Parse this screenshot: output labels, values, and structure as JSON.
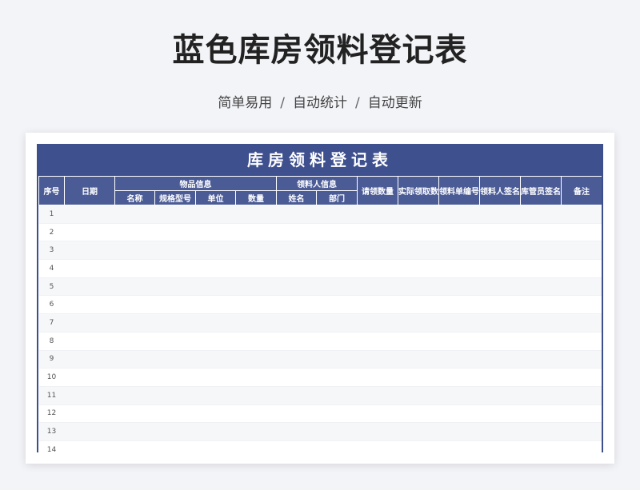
{
  "page": {
    "title": "蓝色库房领料登记表",
    "subtitle": {
      "parts": [
        "简单易用",
        "自动统计",
        "自动更新"
      ],
      "separator": "/"
    }
  },
  "sheet": {
    "title": "库房领料登记表",
    "header": {
      "seq": "序号",
      "date": "日期",
      "item_group": "物品信息",
      "item_name": "名称",
      "item_spec": "规格型号",
      "item_unit": "单位",
      "item_qty": "数量",
      "receiver_group": "领料人信息",
      "receiver_name": "姓名",
      "receiver_dept": "部门",
      "requested_qty": "请领数量",
      "actual_qty": "实际领取数量",
      "order_no": "领料单编号",
      "receiver_sign": "领料人签名",
      "keeper_sign": "库管员签名",
      "remark": "备注"
    },
    "rows": [
      {
        "seq": "1"
      },
      {
        "seq": "2"
      },
      {
        "seq": "3"
      },
      {
        "seq": "4"
      },
      {
        "seq": "5"
      },
      {
        "seq": "6"
      },
      {
        "seq": "7"
      },
      {
        "seq": "8"
      },
      {
        "seq": "9"
      },
      {
        "seq": "10"
      },
      {
        "seq": "11"
      },
      {
        "seq": "12"
      },
      {
        "seq": "13"
      },
      {
        "seq": "14"
      }
    ]
  },
  "colors": {
    "header_bg": "#4b5b96",
    "title_bg": "#3f508f",
    "page_bg": "#f3f4f8"
  }
}
